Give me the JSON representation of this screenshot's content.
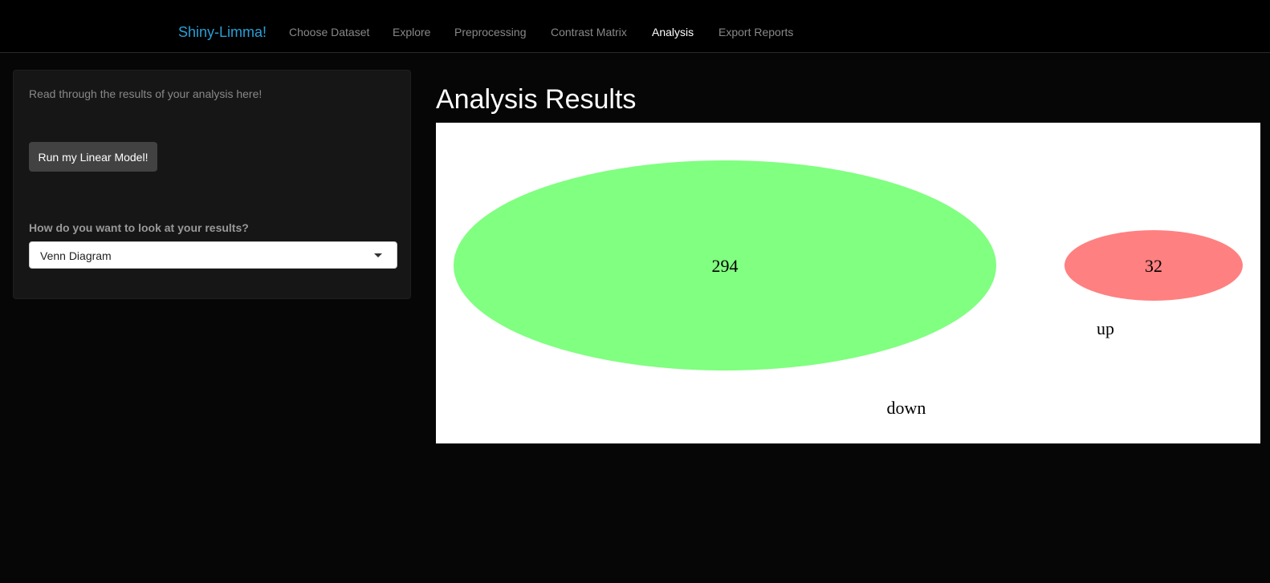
{
  "navbar": {
    "brand": "Shiny-Limma!",
    "items": [
      {
        "label": "Choose Dataset"
      },
      {
        "label": "Explore"
      },
      {
        "label": "Preprocessing"
      },
      {
        "label": "Contrast Matrix"
      },
      {
        "label": "Analysis",
        "active": true
      },
      {
        "label": "Export Reports"
      }
    ]
  },
  "sidebar": {
    "intro": "Read through the results of your analysis here!",
    "run_button": "Run my Linear Model!",
    "view_label": "How do you want to look at your results?",
    "view_select": {
      "selected": "Venn Diagram"
    }
  },
  "main": {
    "title": "Analysis Results"
  },
  "venn": {
    "sets": [
      {
        "name": "down",
        "count": "294",
        "color": "#80ff80"
      },
      {
        "name": "up",
        "count": "32",
        "color": "#ff8080"
      }
    ]
  },
  "colors": {
    "accent": "#2a9fd6",
    "background": "#060606"
  }
}
